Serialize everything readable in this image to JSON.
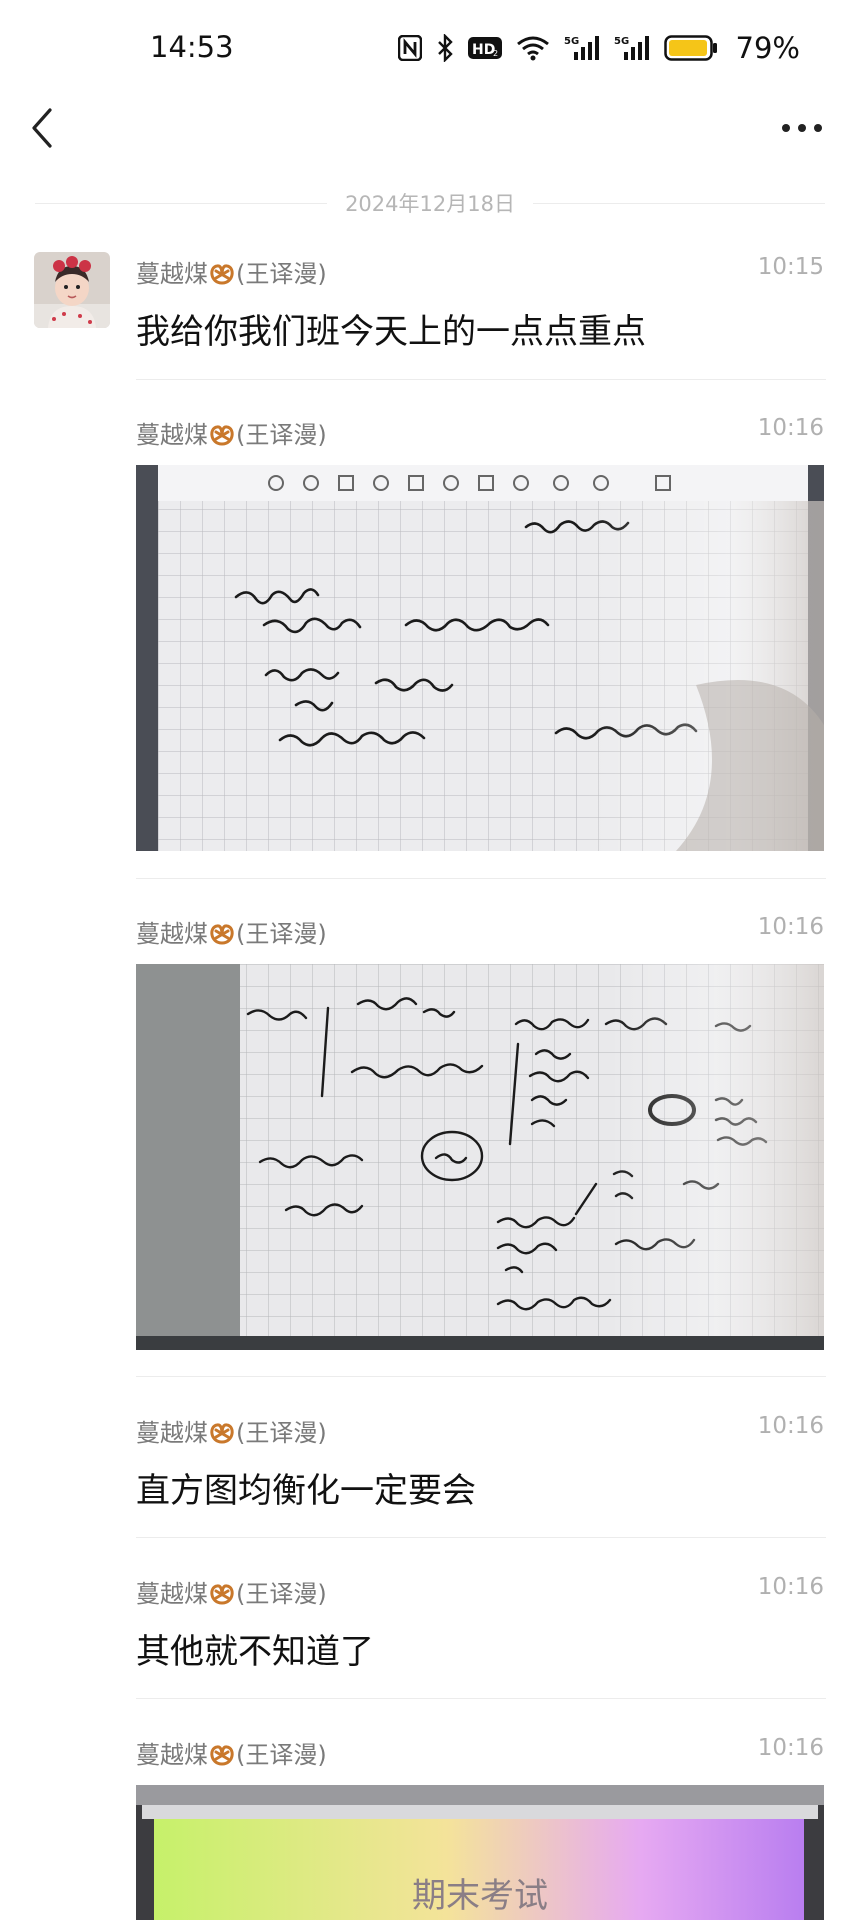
{
  "status_bar": {
    "time": "14:53",
    "battery_percent": "79%",
    "signal_labels": [
      "5G",
      "5G"
    ]
  },
  "nav": {
    "back_icon": "chevron-left-icon",
    "more_icon": "more-dots-icon"
  },
  "date_separator": "2024年12月18日",
  "messages": [
    {
      "sender": "蔓越煤",
      "sender_note": "(王译漫)",
      "time": "10:15",
      "type": "text",
      "text": "我给你我们班今天上的一点点重点"
    },
    {
      "sender": "蔓越煤",
      "sender_note": "(王译漫)",
      "time": "10:16",
      "type": "image"
    },
    {
      "sender": "蔓越煤",
      "sender_note": "(王译漫)",
      "time": "10:16",
      "type": "image"
    },
    {
      "sender": "蔓越煤",
      "sender_note": "(王译漫)",
      "time": "10:16",
      "type": "text",
      "text": "直方图均衡化一定要会"
    },
    {
      "sender": "蔓越煤",
      "sender_note": "(王译漫)",
      "time": "10:16",
      "type": "text",
      "text": "其他就不知道了"
    },
    {
      "sender": "蔓越煤",
      "sender_note": "(王译漫)",
      "time": "10:16",
      "type": "image",
      "caption": "期末考试"
    }
  ],
  "colors": {
    "accent_battery": "#f5c518",
    "text_primary": "#111111",
    "text_secondary": "#7a7a7a",
    "timestamp": "#b0b0b0"
  }
}
